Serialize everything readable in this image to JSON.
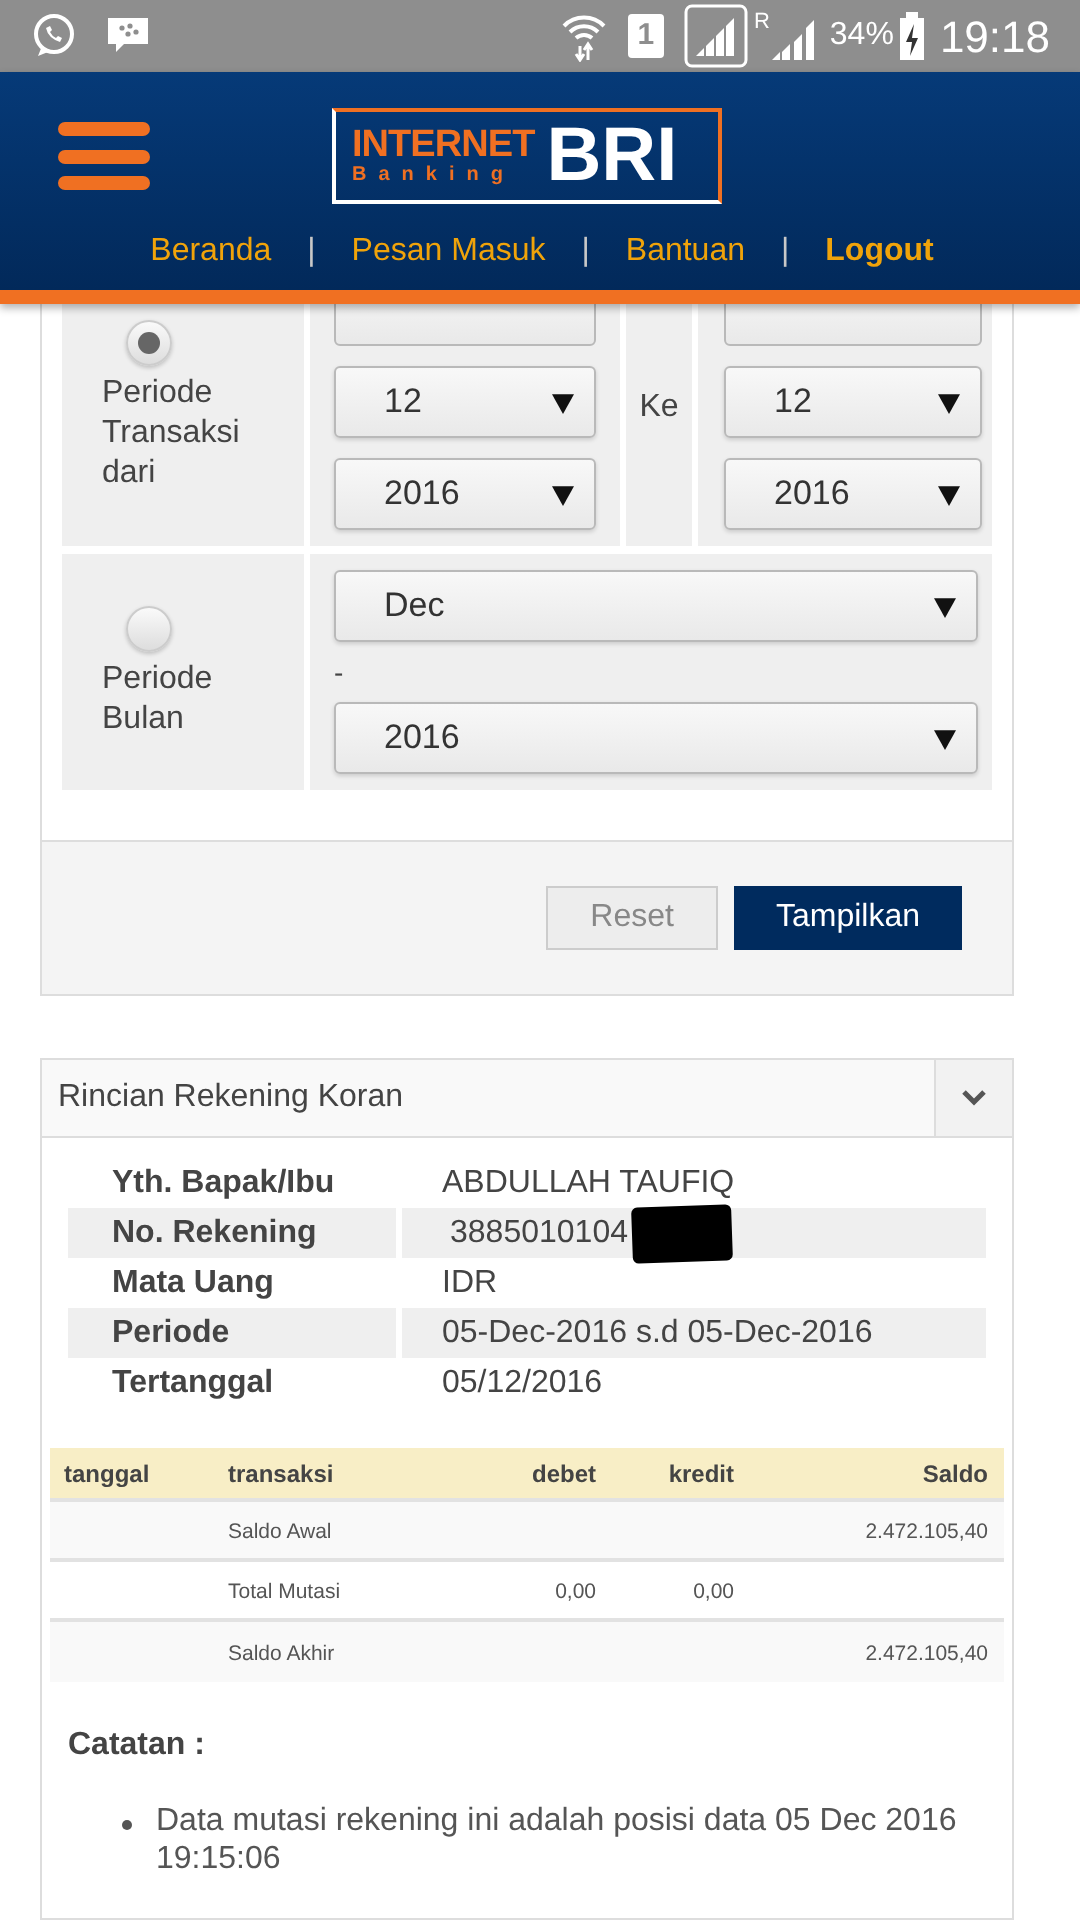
{
  "status_bar": {
    "sim": "1",
    "roaming": "R",
    "battery": "34%",
    "time": "19:18"
  },
  "header": {
    "logo": {
      "line1": "INTERNET",
      "line2": "Banking",
      "brand": "BRI"
    },
    "nav": [
      {
        "label": "Beranda",
        "bold": false
      },
      {
        "label": "Pesan Masuk",
        "bold": false
      },
      {
        "label": "Bantuan",
        "bold": false
      },
      {
        "label": "Logout",
        "bold": true
      }
    ],
    "separator": "|"
  },
  "period_form": {
    "options": [
      {
        "label": "Periode Transaksi dari",
        "selected": true,
        "kind": "range",
        "from": [
          "12",
          "2016"
        ],
        "to_label": "Ke",
        "to": [
          "12",
          "2016"
        ]
      },
      {
        "label": "Periode Bulan",
        "selected": false,
        "kind": "month",
        "month": "Dec",
        "dash": "-",
        "year": "2016"
      }
    ],
    "buttons": [
      {
        "label": "Reset",
        "kind": "secondary"
      },
      {
        "label": "Tampilkan",
        "kind": "primary"
      }
    ]
  },
  "statement": {
    "title": "Rincian Rekening Koran",
    "expanded": true,
    "info": [
      {
        "label": "Yth. Bapak/Ibu",
        "value": "ABDULLAH TAUFIQ",
        "redacted": false
      },
      {
        "label": "No. Rekening",
        "value": "3885010104",
        "redacted": true
      },
      {
        "label": "Mata Uang",
        "value": "IDR",
        "redacted": false
      },
      {
        "label": "Periode",
        "value": "05-Dec-2016 s.d 05-Dec-2016",
        "redacted": false
      },
      {
        "label": "Tertanggal",
        "value": "05/12/2016",
        "redacted": false
      }
    ],
    "table": {
      "columns": [
        "tanggal",
        "transaksi",
        "debet",
        "kredit",
        "Saldo"
      ],
      "rows": [
        [
          "",
          "Saldo Awal",
          "",
          "",
          "2.472.105,40"
        ],
        [
          "",
          "Total Mutasi",
          "0,00",
          "0,00",
          ""
        ],
        [
          "",
          "Saldo Akhir",
          "",
          "",
          "2.472.105,40"
        ]
      ]
    },
    "notes_title": "Catatan :",
    "notes": [
      "Data mutasi rekening ini adalah posisi data 05 Dec 2016 19:15:06"
    ]
  }
}
